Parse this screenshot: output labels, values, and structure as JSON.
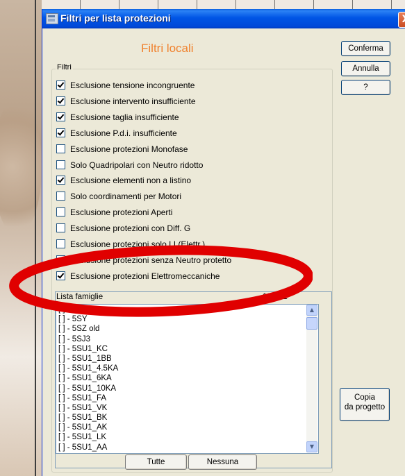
{
  "window": {
    "title": "Filtri per lista protezioni",
    "close_glyph": "X",
    "heading": "Filtri locali"
  },
  "buttons": {
    "confirm": "Conferma",
    "cancel": "Annulla",
    "help": "?",
    "copy_line1": "Copia",
    "copy_line2": "da progetto",
    "all": "Tutte",
    "none": "Nessuna"
  },
  "filters": {
    "group_label": "Filtri",
    "items": [
      {
        "label": "Esclusione tensione incongruente",
        "checked": true
      },
      {
        "label": "Esclusione intervento insufficiente",
        "checked": true
      },
      {
        "label": "Esclusione taglia insufficiente",
        "checked": true
      },
      {
        "label": "Esclusione P.d.i. insufficiente",
        "checked": true
      },
      {
        "label": "Esclusione protezioni Monofase",
        "checked": false
      },
      {
        "label": "Solo Quadripolari con Neutro ridotto",
        "checked": false
      },
      {
        "label": "Esclusione elementi non a listino",
        "checked": true
      },
      {
        "label": "Solo coordinamenti per Motori",
        "checked": false
      },
      {
        "label": "Esclusione protezioni Aperti",
        "checked": false
      },
      {
        "label": "Esclusione protezioni con Diff. G",
        "checked": false
      },
      {
        "label": "Esclusione protezioni solo LI (Elettr.)",
        "checked": false
      },
      {
        "label": "Esclusione protezioni senza Neutro protetto",
        "checked": false
      },
      {
        "label": "Esclusione protezioni Elettromeccaniche",
        "checked": true
      }
    ]
  },
  "families": {
    "header_label": "Lista famiglie",
    "count": "127 - 1",
    "items": [
      "[ ] - 5SZ",
      "[ ] - 5SY",
      "[ ] - 5SZ old",
      "[ ] - 5SJ3",
      "[ ] - 5SU1_KC",
      "[ ] - 5SU1_1BB",
      "[ ] - 5SU1_4.5KA",
      "[ ] - 5SU1_6KA",
      "[ ] - 5SU1_10KA",
      "[ ] - 5SU1_FA",
      "[ ] - 5SU1_VK",
      "[ ] - 5SU1_BK",
      "[ ] - 5SU1_AK",
      "[ ] - 5SU1_LK",
      "[ ] - 5SU1_AA"
    ]
  },
  "colors": {
    "title_bar": "#0055e5",
    "heading": "#f0822e",
    "annotation": "#e00000"
  }
}
